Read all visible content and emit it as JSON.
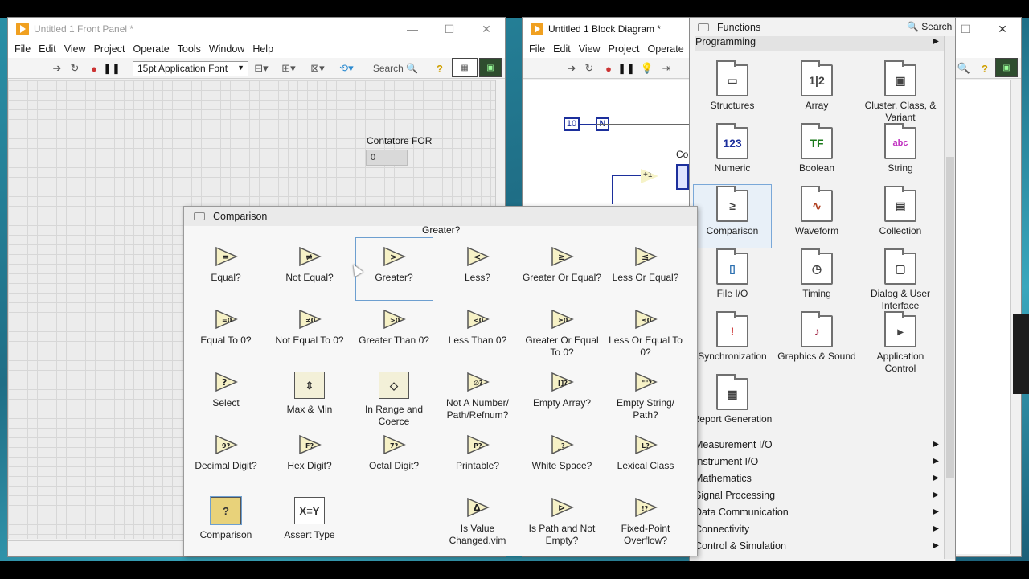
{
  "front_panel": {
    "title": "Untitled 1 Front Panel *",
    "menus": [
      "File",
      "Edit",
      "View",
      "Project",
      "Operate",
      "Tools",
      "Window",
      "Help"
    ],
    "font_selector": "15pt Application Font",
    "search_label": "Search",
    "indicator": {
      "label": "Contatore FOR",
      "value": "0"
    }
  },
  "block_diagram": {
    "title": "Untitled 1 Block Diagram *",
    "menus": [
      "File",
      "Edit",
      "View",
      "Project",
      "Operate"
    ],
    "loop_count": "10",
    "loop_n": "N",
    "increment": "+1",
    "partial_label": "Co"
  },
  "functions_palette": {
    "title": "Functions",
    "search_label": "Search",
    "category": "Programming",
    "items": [
      {
        "label": "Structures",
        "glyph": "▭"
      },
      {
        "label": "Array",
        "glyph": "1|2"
      },
      {
        "label": "Cluster, Class, & Variant",
        "glyph": "▣"
      },
      {
        "label": "Numeric",
        "glyph": "123"
      },
      {
        "label": "Boolean",
        "glyph": "TF"
      },
      {
        "label": "String",
        "glyph": "abc"
      },
      {
        "label": "Comparison",
        "glyph": "≥"
      },
      {
        "label": "Waveform",
        "glyph": "∿"
      },
      {
        "label": "Collection",
        "glyph": "▤"
      },
      {
        "label": "File I/O",
        "glyph": "▯"
      },
      {
        "label": "Timing",
        "glyph": "◷"
      },
      {
        "label": "Dialog & User Interface",
        "glyph": "▢"
      },
      {
        "label": "Synchronization",
        "glyph": "!"
      },
      {
        "label": "Graphics & Sound",
        "glyph": "♪"
      },
      {
        "label": "Application Control",
        "glyph": "▸"
      },
      {
        "label": "Report Generation",
        "glyph": "▦"
      }
    ],
    "categories": [
      "Measurement I/O",
      "Instrument I/O",
      "Mathematics",
      "Signal Processing",
      "Data Communication",
      "Connectivity",
      "Control & Simulation"
    ]
  },
  "comparison_palette": {
    "title": "Comparison",
    "tooltip": "Greater?",
    "items": [
      {
        "label": "Equal?",
        "glyph": "="
      },
      {
        "label": "Not Equal?",
        "glyph": "≠"
      },
      {
        "label": "Greater?",
        "glyph": ">"
      },
      {
        "label": "Less?",
        "glyph": "<"
      },
      {
        "label": "Greater Or Equal?",
        "glyph": "≥"
      },
      {
        "label": "Less Or Equal?",
        "glyph": "≤"
      },
      {
        "label": "Equal To 0?",
        "glyph": "=0"
      },
      {
        "label": "Not Equal To 0?",
        "glyph": "≠0"
      },
      {
        "label": "Greater Than 0?",
        "glyph": ">0"
      },
      {
        "label": "Less Than 0?",
        "glyph": "<0"
      },
      {
        "label": "Greater Or Equal To 0?",
        "glyph": "≥0"
      },
      {
        "label": "Less Or Equal To 0?",
        "glyph": "≤0"
      },
      {
        "label": "Select",
        "glyph": "?"
      },
      {
        "label": "Max & Min",
        "glyph": "⇕"
      },
      {
        "label": "In Range and Coerce",
        "glyph": "◇"
      },
      {
        "label": "Not A Number/ Path/Refnum?",
        "glyph": "∅?"
      },
      {
        "label": "Empty Array?",
        "glyph": "[]?"
      },
      {
        "label": "Empty String/ Path?",
        "glyph": "\"\"?"
      },
      {
        "label": "Decimal Digit?",
        "glyph": "9?"
      },
      {
        "label": "Hex Digit?",
        "glyph": "F?"
      },
      {
        "label": "Octal Digit?",
        "glyph": "7?"
      },
      {
        "label": "Printable?",
        "glyph": "P?"
      },
      {
        "label": "White Space?",
        "glyph": "_?"
      },
      {
        "label": "Lexical Class",
        "glyph": "L?"
      },
      {
        "label": "Comparison",
        "glyph": "?"
      },
      {
        "label": "Assert Type",
        "glyph": "X≡Y"
      },
      {
        "label": "",
        "glyph": ""
      },
      {
        "label": "Is Value Changed.vim",
        "glyph": "Δ"
      },
      {
        "label": "Is Path and Not Empty?",
        "glyph": "⊳"
      },
      {
        "label": "Fixed-Point Overflow?",
        "glyph": "!?"
      }
    ]
  }
}
